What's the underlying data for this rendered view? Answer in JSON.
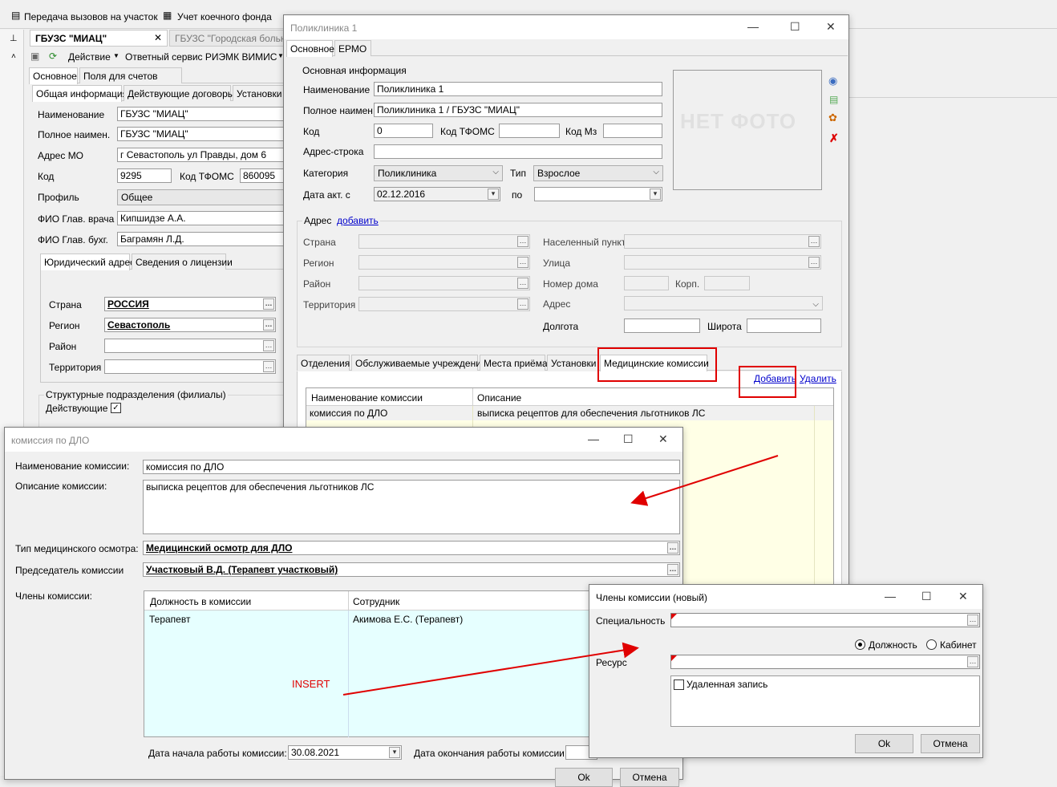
{
  "menubar": {
    "items": [
      "Передача вызовов на участок",
      "Учет коечного фонда"
    ]
  },
  "main": {
    "doc_tabs": [
      "ГБУЗС \"МИАЦ\"",
      "ГБУЗС \"Городская больн"
    ],
    "toolbar": {
      "action": "Действие",
      "service": "Ответный сервис РИЭМК ВИМИС"
    },
    "tabs": [
      "Основное",
      "Поля для счетов"
    ],
    "subtabs": [
      "Общая информация",
      "Действующие договоры",
      "Установки"
    ],
    "labels": {
      "name": "Наименование",
      "fullname": "Полное наимен.",
      "address": "Адрес МО",
      "code": "Код",
      "code_tfoms": "Код ТФОМС",
      "profile": "Профиль",
      "chief": "ФИО Глав. врача",
      "accountant": "ФИО Глав. бухг."
    },
    "values": {
      "name": "ГБУЗС \"МИАЦ\"",
      "fullname": "ГБУЗС \"МИАЦ\"",
      "address": "г Севастополь  ул Правды, дом 6",
      "code": "9295",
      "code_tfoms": "860095",
      "profile": "Общее",
      "chief": "Кипшидзе А.А.",
      "accountant": "Баграмян Л.Д."
    },
    "addr_tabs": [
      "Юридический адрес",
      "Сведения о лицензии"
    ],
    "addr_labels": {
      "country": "Страна",
      "region": "Регион",
      "district": "Район",
      "territory": "Территория"
    },
    "addr_values": {
      "country": "РОССИЯ",
      "region": "Севастополь"
    },
    "struct_title": "Структурные подразделения (филиалы)",
    "active_label": "Действующие"
  },
  "clinic": {
    "title": "Поликлиника 1",
    "tabs": [
      "Основное",
      "ЕРМО"
    ],
    "group_main": "Основная информация",
    "labels": {
      "name": "Наименование",
      "fullname": "Полное наимен.",
      "code": "Код",
      "code_tfoms": "Код ТФОМС",
      "code_mz": "Код Мз",
      "addr_line": "Адрес-строка",
      "category": "Категория",
      "type": "Тип",
      "date_from": "Дата акт. с",
      "date_to": "по"
    },
    "values": {
      "name": "Поликлиника 1",
      "fullname": "Поликлиника 1 / ГБУЗС \"МИАЦ\"",
      "code": "0",
      "category": "Поликлиника",
      "type": "Взрослое",
      "date_from": "02.12.2016"
    },
    "photo": "НЕТ ФОТО",
    "group_addr": "Адрес",
    "addr_add": "добавить",
    "addr_labels": {
      "country": "Страна",
      "region": "Регион",
      "district": "Район",
      "territory": "Территория",
      "settlement": "Населенный пункт",
      "street": "Улица",
      "house": "Номер дома",
      "korp": "Корп.",
      "address": "Адрес",
      "longitude": "Долгота",
      "latitude": "Широта"
    },
    "bottom_tabs": [
      "Отделения",
      "Обслуживаемые учреждения",
      "Места приёма",
      "Установки",
      "Медицинские комиссии"
    ],
    "add_link": "Добавить",
    "delete_link": "Удалить",
    "grid_headers": [
      "Наименование комиссии",
      "Описание"
    ],
    "grid_rows": [
      {
        "name": "комиссия по ДЛО",
        "desc": "выписка рецептов для обеспечения льготников ЛС"
      }
    ]
  },
  "commission": {
    "title": "комиссия по ДЛО",
    "labels": {
      "name": "Наименование комиссии:",
      "desc": "Описание комиссии:",
      "exam_type": "Тип медицинского осмотра:",
      "chair": "Председатель комиссии",
      "members": "Члены комиссии:",
      "start": "Дата начала работы комиссии:",
      "end": "Дата окончания работы комиссии:"
    },
    "values": {
      "name": "комиссия по ДЛО",
      "desc": "выписка рецептов для обеспечения льготников ЛС",
      "exam_type": "Медицинский осмотр для ДЛО",
      "chair": "Участковый В.Д. (Терапевт участковый)",
      "start": "30.08.2021"
    },
    "members_headers": [
      "Должность в комиссии",
      "Сотрудник"
    ],
    "members_rows": [
      {
        "role": "Терапевт",
        "employee": "Акимова Е.С. (Терапевт)"
      }
    ],
    "insert_note": "INSERT",
    "ok": "Ok",
    "cancel": "Отмена"
  },
  "member_dialog": {
    "title": "Члены комиссии (новый)",
    "labels": {
      "specialty": "Специальность",
      "resource": "Ресурс"
    },
    "radio_position": "Должность",
    "radio_cabinet": "Кабинет",
    "deleted": "Удаленная запись",
    "ok": "Ok",
    "cancel": "Отмена"
  },
  "colors": {
    "highlight": "#e00000",
    "grid_yellow": "#ffffe6",
    "grid_cyan": "#e6ffff",
    "link": "#0000cc"
  }
}
